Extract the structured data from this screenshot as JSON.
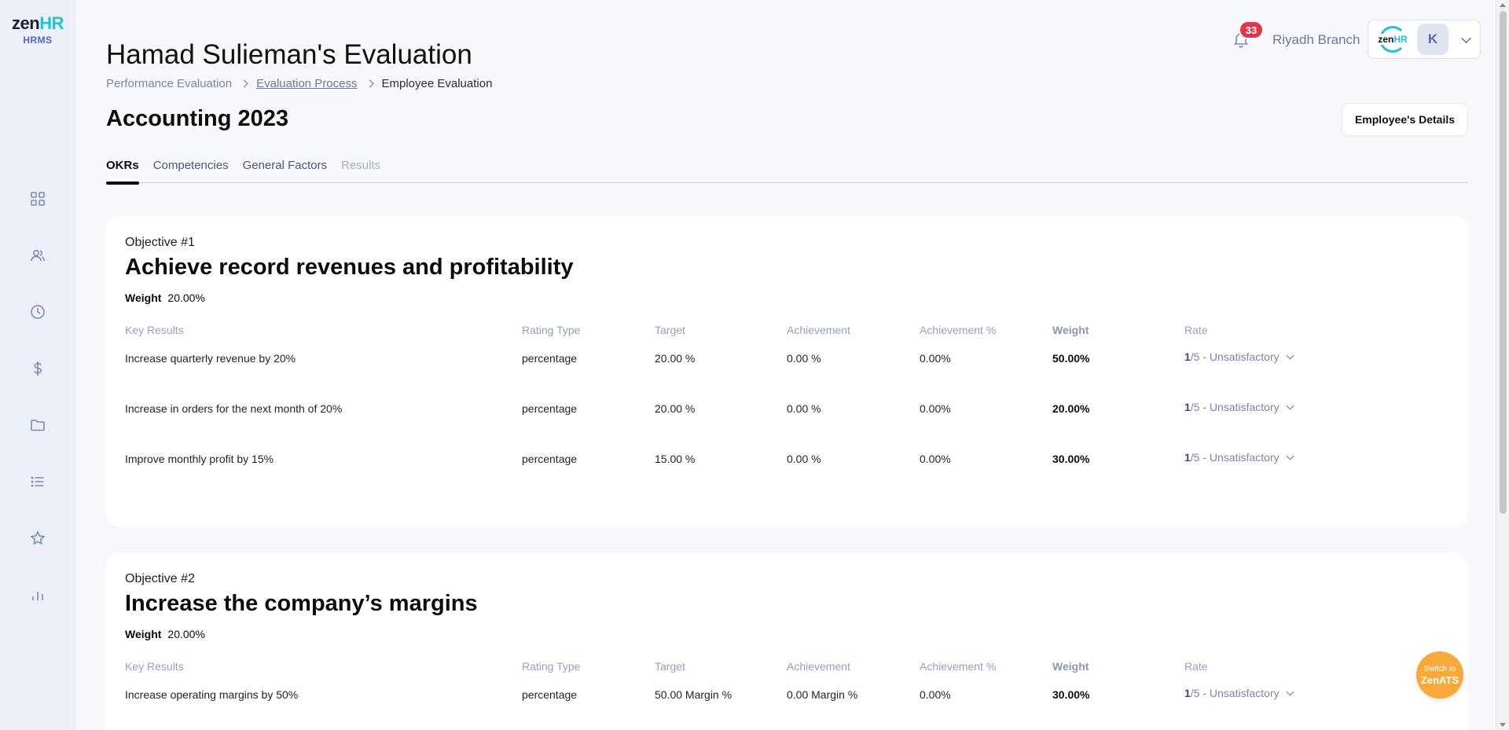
{
  "logo": {
    "brand_zen": "zen",
    "brand_hr": "HR",
    "sub": "HRMS"
  },
  "sidebar": {
    "icons": [
      "grid-icon",
      "users-icon",
      "clock-icon",
      "dollar-icon",
      "folder-icon",
      "list-icon",
      "star-icon",
      "bar-chart-icon"
    ]
  },
  "header": {
    "title": "Hamad Sulieman's Evaluation",
    "breadcrumb": [
      "Performance Evaluation",
      "Evaluation Process",
      "Employee Evaluation"
    ],
    "section_title": "Accounting 2023",
    "notification_count": "33",
    "branch": "Riyadh Branch",
    "account_logo_zen": "zen",
    "account_logo_hr": "HR",
    "avatar_initial": "K",
    "details_button": "Employee's Details"
  },
  "tabs": [
    {
      "label": "OKRs",
      "state": "active"
    },
    {
      "label": "Competencies",
      "state": "normal"
    },
    {
      "label": "General Factors",
      "state": "normal"
    },
    {
      "label": "Results",
      "state": "disabled"
    }
  ],
  "columns": [
    "Key Results",
    "Rating Type",
    "Target",
    "Achievement",
    "Achievement %",
    "Weight",
    "Rate"
  ],
  "objectives": [
    {
      "label": "Objective #1",
      "title": "Achieve record revenues and profitability",
      "weight_label": "Weight",
      "weight_value": "20.00%",
      "rows": [
        {
          "key_result": "Increase quarterly revenue by 20%",
          "rating_type": "percentage",
          "target": "20.00 %",
          "achievement": "0.00 %",
          "achievement_pct": "0.00%",
          "weight": "50.00%",
          "rate_num": "1",
          "rate_text": "/5 - Unsatisfactory"
        },
        {
          "key_result": "Increase in orders for the next month of 20%",
          "rating_type": "percentage",
          "target": "20.00 %",
          "achievement": "0.00 %",
          "achievement_pct": "0.00%",
          "weight": "20.00%",
          "rate_num": "1",
          "rate_text": "/5 - Unsatisfactory"
        },
        {
          "key_result": "Improve monthly profit by 15%",
          "rating_type": "percentage",
          "target": "15.00 %",
          "achievement": "0.00 %",
          "achievement_pct": "0.00%",
          "weight": "30.00%",
          "rate_num": "1",
          "rate_text": "/5 - Unsatisfactory"
        }
      ]
    },
    {
      "label": "Objective #2",
      "title": "Increase the company’s margins",
      "weight_label": "Weight",
      "weight_value": "20.00%",
      "rows": [
        {
          "key_result": "Increase operating margins by 50%",
          "rating_type": "percentage",
          "target": "50.00 Margin %",
          "achievement": "0.00 Margin %",
          "achievement_pct": "0.00%",
          "weight": "30.00%",
          "rate_num": "1",
          "rate_text": "/5 - Unsatisfactory"
        }
      ]
    }
  ],
  "switch_button": {
    "line1": "Switch to",
    "line2": "ZenATS"
  },
  "colors": {
    "accent": "#22c3cf",
    "badge": "#e2344a",
    "switch": "#f7a93c",
    "sidebar": "#edf0f9"
  }
}
